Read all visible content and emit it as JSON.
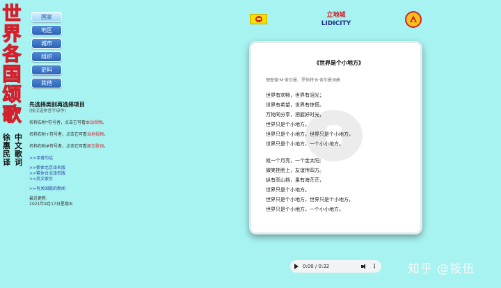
{
  "side_title": {
    "chars": [
      "世",
      "界",
      "各",
      "国",
      "颂",
      "歌"
    ]
  },
  "side_subtitle": {
    "col1": [
      "徐",
      "惠",
      "民",
      "译"
    ],
    "col2": [
      "中",
      "文",
      "歌",
      "词"
    ]
  },
  "nav": {
    "items": [
      "国家",
      "地区",
      "城市",
      "组织",
      "史料",
      "其他"
    ]
  },
  "info": {
    "heading": "先选择类别再选择项目",
    "subheading": "(按汉语拼音字母序)",
    "note1_pre": "名称右附*符号者，点击它可看",
    "note1_red": "本站视频",
    "note1_post": "。",
    "note2_pre": "名称右附+符号者，点击它可看",
    "note2_red": "当地视频",
    "note2_post": "。",
    "note3_pre": "名称右附#符号者，点击它可看",
    "note3_red": "原文歌词",
    "note3_post": "。",
    "link_translator": ">>译者的话",
    "link_beijing": ">>繁体北京译名版",
    "link_taipei": ">>繁体台北译名版",
    "link_english": ">>英文索引",
    "link_news": ">>有关国歌的新闻",
    "updated_label": "最近更新:",
    "updated_date": "2021年9月17日星期五"
  },
  "header": {
    "title_cn": "立地城",
    "title_en": "LIDICITY"
  },
  "lyrics": {
    "title": "《世界是个小地方》",
    "credit": "理查德·M·舍尔曼、罗伯特·B·舍尔曼词曲",
    "stanza1": [
      "世界有欢畅，世界有泪光；",
      "世界有希望，世界有惊慌。",
      "万物同分享，把握好时光，",
      "世界只是个小地方。",
      "世界只是个小地方，世界只是个小地方，",
      "世界只是个小地方，一个小小地方。"
    ],
    "stanza2": [
      "就一个月亮，一个金太阳;",
      "微笑挂脸上，友谊传四方。",
      "纵有高山挡，虽有海茫茫，",
      "世界只是个小地方。",
      "世界只是个小地方，世界只是个小地方，",
      "世界只是个小地方，一个小小地方。"
    ]
  },
  "player": {
    "time": "0:00 / 0:32"
  },
  "watermark": "知乎 @筱伍"
}
